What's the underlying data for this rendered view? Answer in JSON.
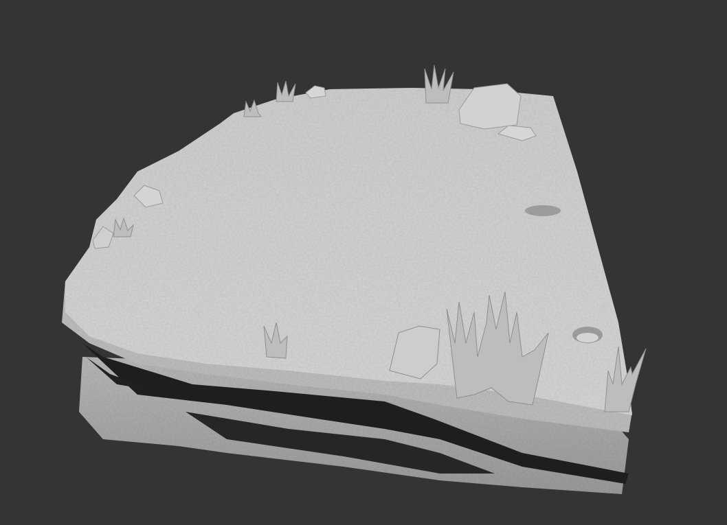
{
  "scene": {
    "colors": {
      "background": "#343434",
      "surface": "#c9c9c9",
      "surface_light": "#d8d8d8",
      "side": "#a9a9a9",
      "shadow": "#1c1c1c",
      "rock": "#cfcfcf",
      "grass": "#b5b5b5"
    }
  }
}
